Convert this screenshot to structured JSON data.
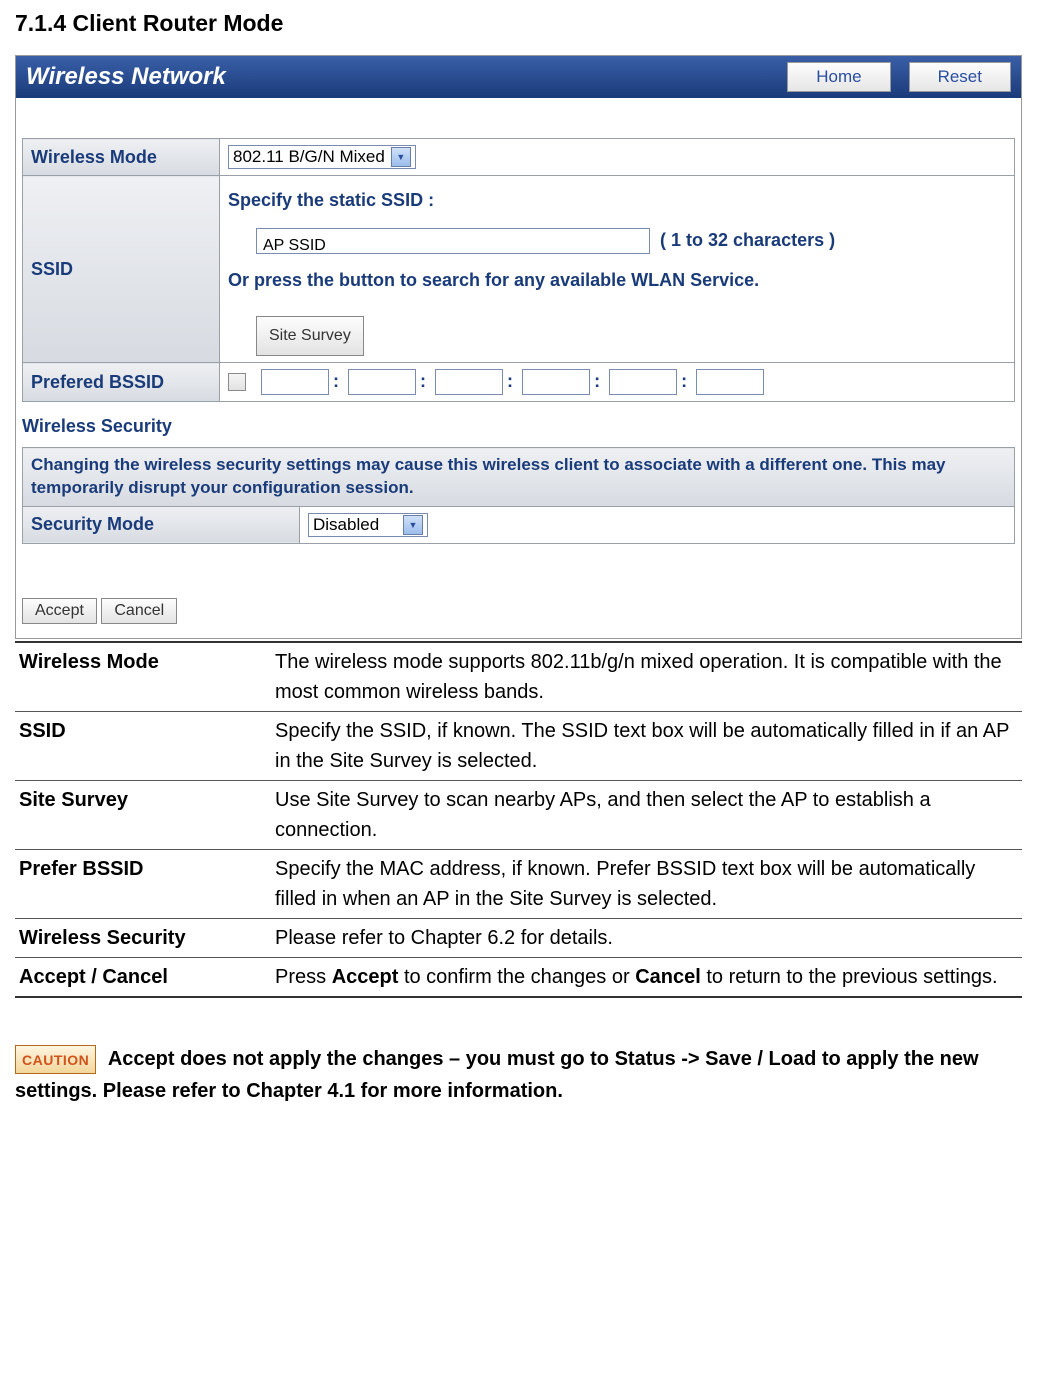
{
  "section_title": "7.1.4 Client Router Mode",
  "panel": {
    "title": "Wireless Network",
    "home_btn": "Home",
    "reset_btn": "Reset"
  },
  "wireless_mode": {
    "label": "Wireless Mode",
    "value": "802.11 B/G/N Mixed"
  },
  "ssid": {
    "label": "SSID",
    "specify_text": "Specify the static SSID  :",
    "input_value": "AP SSID",
    "chars_note": "( 1 to 32 characters )",
    "or_text": "Or press the button to search for any available WLAN Service.",
    "site_survey_btn": "Site Survey"
  },
  "bssid": {
    "label": "Prefered BSSID"
  },
  "wireless_security_heading": "Wireless Security",
  "security_warning": "Changing the wireless security settings may cause this wireless client to associate with a different one. This may temporarily disrupt your configuration session.",
  "security_mode": {
    "label": "Security Mode",
    "value": "Disabled"
  },
  "accept_btn": "Accept",
  "cancel_btn": "Cancel",
  "desc": [
    {
      "term": "Wireless Mode",
      "def": "The wireless mode supports 802.11b/g/n mixed operation. It is compatible with the most common wireless bands."
    },
    {
      "term": "SSID",
      "def": "Specify the SSID, if known. The SSID text box will be automatically filled in if an AP in the Site Survey is selected."
    },
    {
      "term": "Site Survey",
      "def": "Use Site Survey to scan nearby APs, and then select the AP to establish a connection."
    },
    {
      "term": "Prefer BSSID",
      "def": "Specify the MAC address, if known. Prefer BSSID text box will be automatically filled in when an AP in the Site Survey is selected."
    },
    {
      "term": "Wireless Security",
      "def": "Please refer to Chapter 6.2 for details."
    }
  ],
  "desc_accept_cancel": {
    "term": "Accept / Cancel",
    "pre": "Press ",
    "accept": "Accept",
    "mid": " to confirm the changes or ",
    "cancel": "Cancel",
    "post": " to return to the previous settings."
  },
  "caution": {
    "badge": "CAUTION",
    "text": " Accept does not apply the changes – you must go to Status -> Save / Load to apply the new settings. Please refer to Chapter 4.1 for more information."
  }
}
